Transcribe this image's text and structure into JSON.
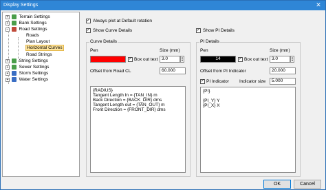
{
  "window": {
    "title": "Display Settings",
    "close_glyph": "✕"
  },
  "tree": [
    {
      "label": "Terrain Settings",
      "expander": "+",
      "icon_color": "#4a9e4a"
    },
    {
      "label": "Bank Settings",
      "expander": "+",
      "icon_color": "#4a9e4a"
    },
    {
      "label": "Road Settings",
      "expander": "−",
      "icon_color": "#c04a3a"
    },
    {
      "label": "Roads"
    },
    {
      "label": "Plan Layout"
    },
    {
      "label": "Horizontal Curves"
    },
    {
      "label": "Road Strings"
    },
    {
      "label": "String Settings",
      "expander": "+",
      "icon_color": "#4a9e4a"
    },
    {
      "label": "Sewer Settings",
      "expander": "+",
      "icon_color": "#4a9e4a"
    },
    {
      "label": "Storm Settings",
      "expander": "+",
      "icon_color": "#3a6ec4"
    },
    {
      "label": "Water Settings",
      "expander": "+",
      "icon_color": "#3a6ec4"
    }
  ],
  "always_plot": {
    "label": "Always plot at Default rotation",
    "checked": true
  },
  "show_curve_details": {
    "label": "Show Curve Details",
    "checked": true
  },
  "show_pi_details": {
    "label": "Show PI Details",
    "checked": true
  },
  "curve_details": {
    "title": "Curve Details",
    "pen_label": "Pen",
    "pen_color": "#ff0000",
    "box_out_text": {
      "label": "Box out text",
      "checked": true
    },
    "size_label": "Size (mm)",
    "size_value": "3.0",
    "offset_label": "Offset from Road CL",
    "offset_value": "60.000",
    "template": "{RADIUS}\nTangent Length In = {TAN_IN} m\nBack Direction = {BACK_DIR} dms\nTangent Length out = {TAN_OUT} m\nFront Direction = {FRONT_DIR} dms"
  },
  "pi_details": {
    "title": "PI Details",
    "pen_label": "Pen",
    "pen_color": "#000000",
    "pen_value": "14",
    "box_out_text": {
      "label": "Box out text",
      "checked": true
    },
    "size_label": "Size (mm)",
    "size_value": "3.0",
    "offset_label": "Offset from PI Indicator",
    "offset_value": "20.000",
    "pi_indicator": {
      "label": "PI Indicator",
      "checked": true
    },
    "indicator_size_label": "Indicator size",
    "indicator_size_value": "5.000",
    "template": "{PI}\n\n{PI_Y} Y\n{PI_X} X"
  },
  "buttons": {
    "ok": "OK",
    "cancel": "Cancel"
  },
  "check_glyph": "✓"
}
